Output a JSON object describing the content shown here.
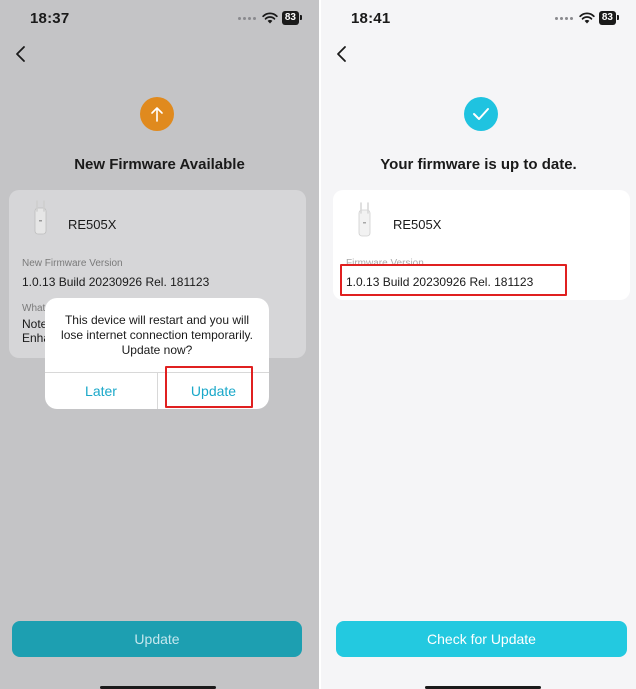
{
  "left_screen": {
    "status_time": "18:37",
    "battery": "83",
    "heading": "New Firmware Available",
    "device_name": "RE505X",
    "fw_label": "New Firmware Version",
    "fw_version": "1.0.13 Build 20230926 Rel. 181123",
    "whats_new_label": "What",
    "notes_text": "Note\nEnha",
    "dialog": {
      "message": "This device will restart and you will lose internet connection temporarily. Update now?",
      "later_label": "Later",
      "update_label": "Update"
    },
    "bottom_button": "Update",
    "colors": {
      "accent": "#e08a1e",
      "button": "#1d9fb1"
    }
  },
  "right_screen": {
    "status_time": "18:41",
    "battery": "83",
    "heading": "Your firmware is up to date.",
    "device_name": "RE505X",
    "fw_label": "Firmware Version",
    "fw_version": "1.0.13 Build 20230926 Rel. 181123",
    "bottom_button": "Check for Update",
    "colors": {
      "accent": "#1fc3e0",
      "button": "#23c9e0"
    }
  },
  "annotations": {
    "highlight_color": "#e02020"
  }
}
